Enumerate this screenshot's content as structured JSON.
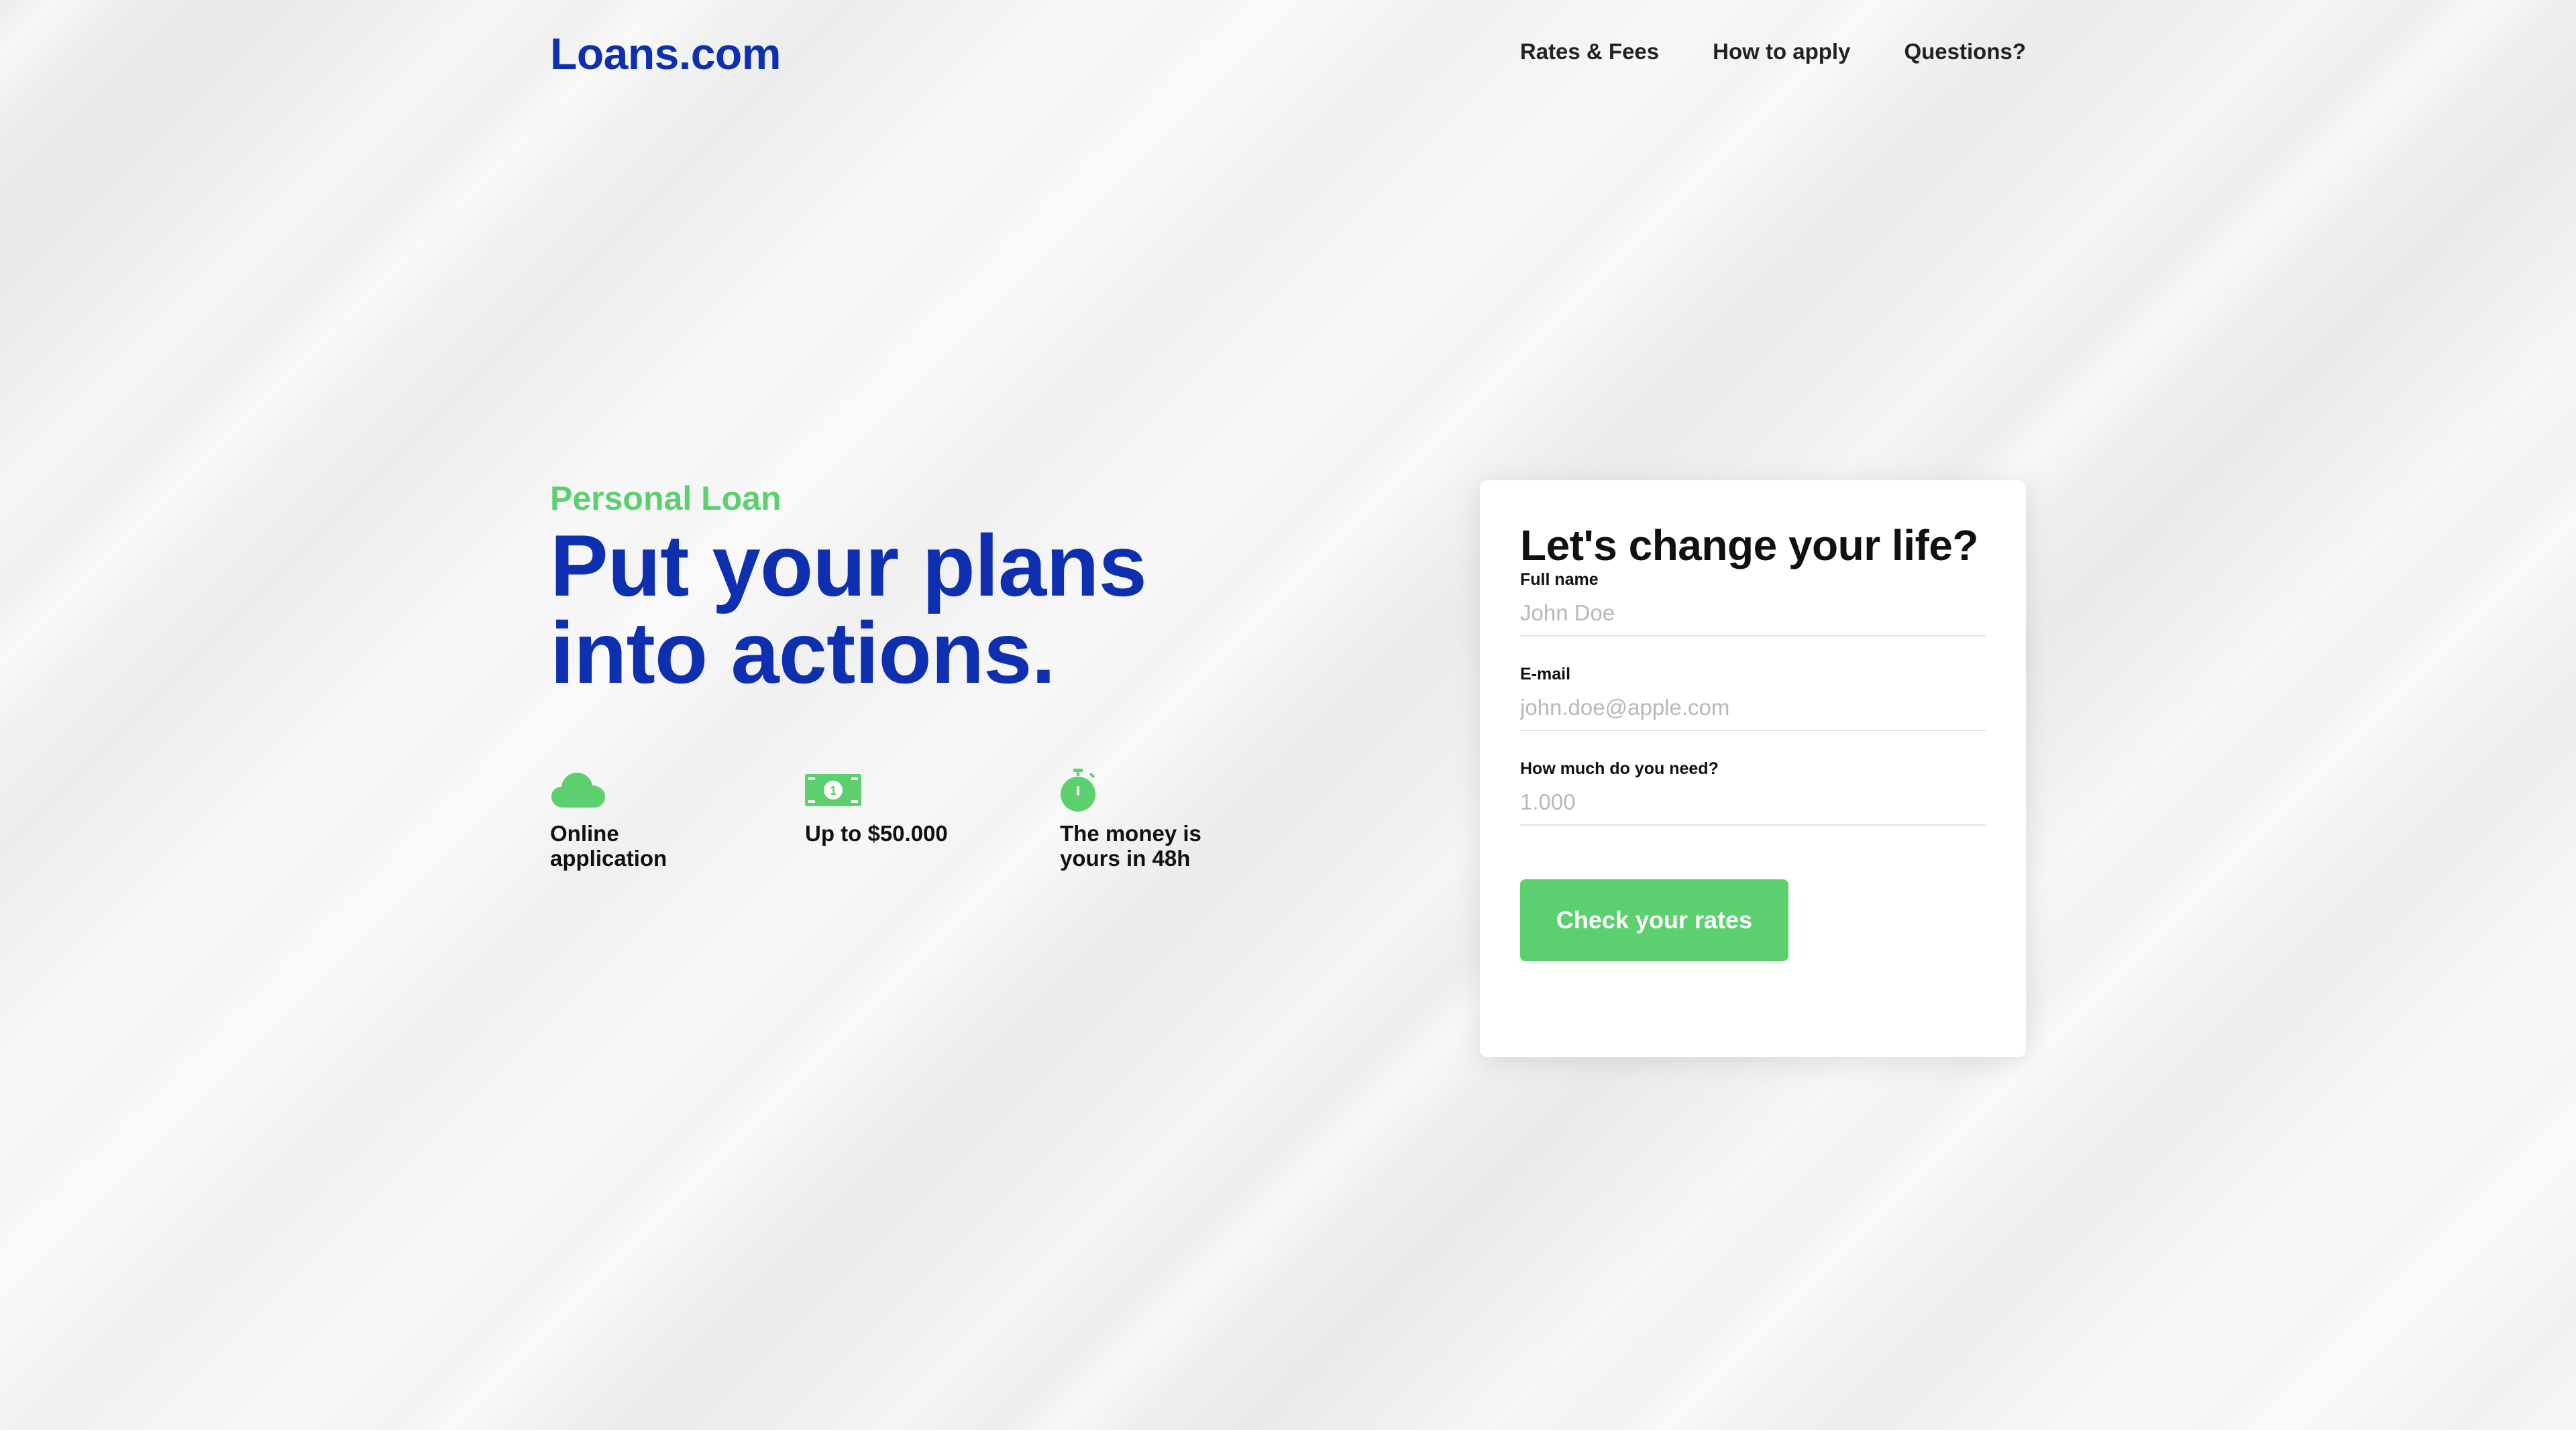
{
  "header": {
    "logo": "Loans.com",
    "nav": [
      "Rates & Fees",
      "How to apply",
      "Questions?"
    ]
  },
  "hero": {
    "eyebrow": "Personal Loan",
    "headline": "Put your plans into actions.",
    "features": [
      {
        "icon": "cloud-icon",
        "label": "Online application"
      },
      {
        "icon": "banknote-icon",
        "label": "Up to $50.000"
      },
      {
        "icon": "stopwatch-icon",
        "label": "The money is yours in 48h"
      }
    ]
  },
  "form": {
    "title": "Let's change your life?",
    "fields": [
      {
        "label": "Full name",
        "placeholder": "John Doe",
        "value": ""
      },
      {
        "label": "E-mail",
        "placeholder": "john.doe@apple.com",
        "value": ""
      },
      {
        "label": "How much do you need?",
        "placeholder": "1.000",
        "value": ""
      }
    ],
    "submit_label": "Check your rates"
  },
  "colors": {
    "brand_blue": "#0d2fb0",
    "accent_green": "#5ccf6f",
    "text_dark": "#111111"
  }
}
